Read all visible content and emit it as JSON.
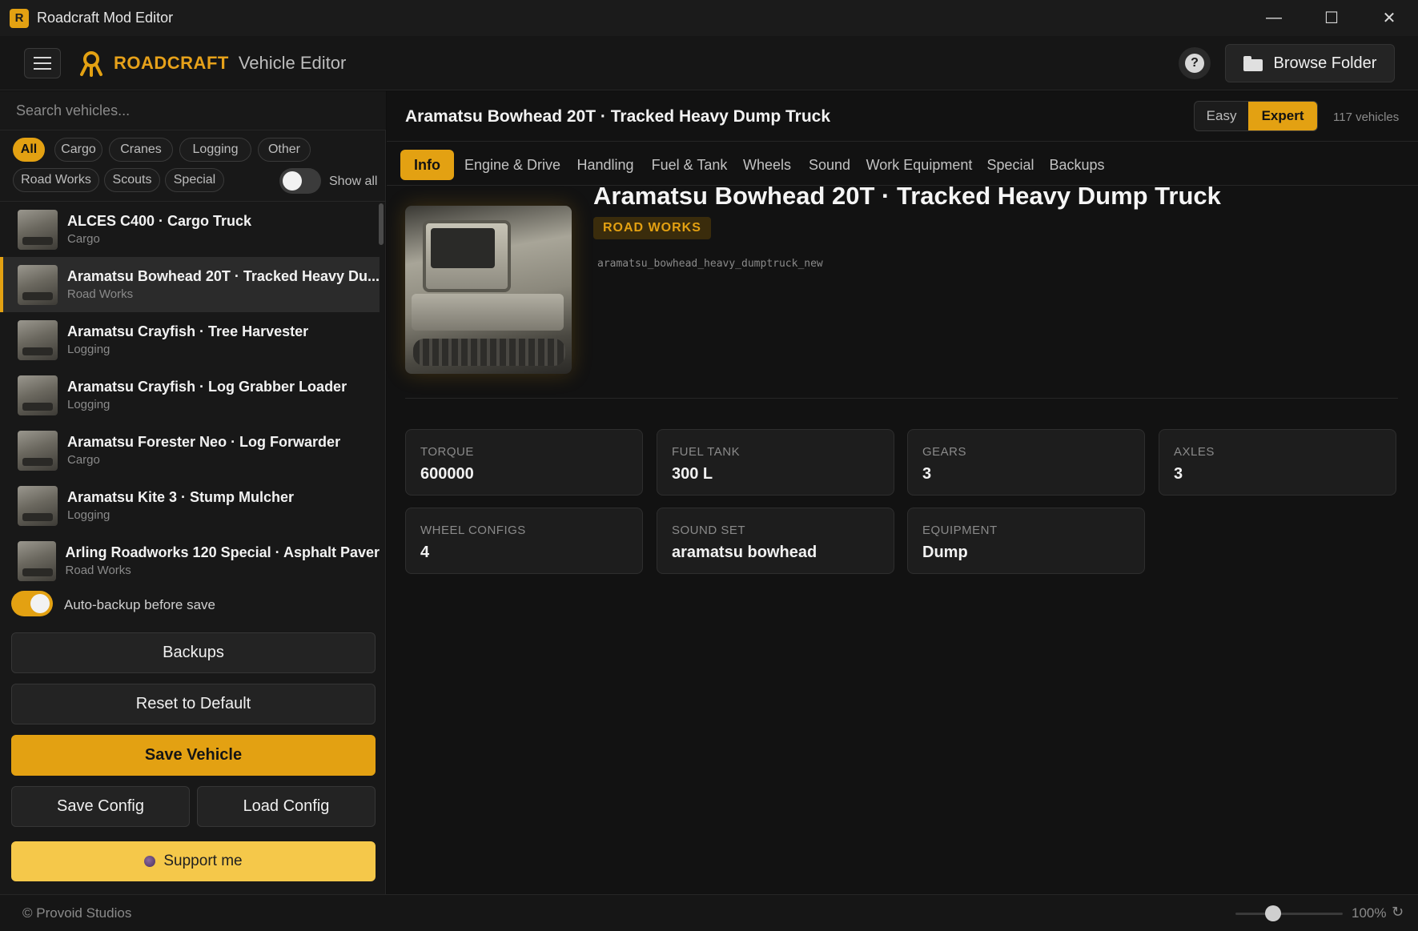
{
  "window": {
    "title": "Roadcraft Mod Editor",
    "controls": {
      "minimize": "—",
      "maximize": "☐",
      "close": "✕"
    }
  },
  "header": {
    "brand": "ROADCRAFT",
    "subtitle": "Vehicle Editor",
    "help": "?",
    "browse_label": "Browse Folder"
  },
  "sidebar": {
    "search_placeholder": "Search vehicles...",
    "filters": [
      "All",
      "Cargo",
      "Cranes",
      "Logging",
      "Other",
      "Road Works",
      "Scouts",
      "Special"
    ],
    "active_filter": "All",
    "show_all_label": "Show all",
    "show_all_on": false,
    "vehicles": [
      {
        "name": "ALCES C400 · Cargo Truck",
        "category": "Cargo",
        "selected": false
      },
      {
        "name": "Aramatsu Bowhead 20T · Tracked Heavy Du...",
        "category": "Road Works",
        "selected": true
      },
      {
        "name": "Aramatsu Crayfish · Tree Harvester",
        "category": "Logging",
        "selected": false
      },
      {
        "name": "Aramatsu Crayfish · Log Grabber Loader",
        "category": "Logging",
        "selected": false
      },
      {
        "name": "Aramatsu Forester Neo · Log Forwarder",
        "category": "Cargo",
        "selected": false
      },
      {
        "name": "Aramatsu Kite 3 · Stump Mulcher",
        "category": "Logging",
        "selected": false
      },
      {
        "name": "Arling Roadworks 120 Special · Asphalt Paver",
        "category": "Road Works",
        "selected": false
      }
    ],
    "autobackup_label": "Auto-backup before save",
    "autobackup_on": true,
    "buttons": {
      "backups": "Backups",
      "reset": "Reset to Default",
      "save_vehicle": "Save Vehicle",
      "save_config": "Save Config",
      "load_config": "Load Config",
      "support": "Support me"
    }
  },
  "main": {
    "title": "Aramatsu Bowhead 20T · Tracked Heavy Dump Truck",
    "mode": {
      "easy": "Easy",
      "expert": "Expert",
      "active": "Expert"
    },
    "vehicle_count": "117 vehicles",
    "tabs": [
      "Info",
      "Engine & Drive",
      "Handling",
      "Fuel & Tank",
      "Wheels",
      "Sound",
      "Work Equipment",
      "Special",
      "Backups"
    ],
    "active_tab": "Info",
    "vehicle": {
      "name": "Aramatsu Bowhead 20T · Tracked Heavy Dump Truck",
      "category_badge": "ROAD WORKS",
      "identifier": "aramatsu_bowhead_heavy_dumptruck_new"
    },
    "stats": [
      {
        "label": "TORQUE",
        "value": "600000"
      },
      {
        "label": "FUEL TANK",
        "value": "300 L"
      },
      {
        "label": "GEARS",
        "value": "3"
      },
      {
        "label": "AXLES",
        "value": "3"
      },
      {
        "label": "WHEEL CONFIGS",
        "value": "4"
      },
      {
        "label": "SOUND SET",
        "value": "aramatsu bowhead"
      },
      {
        "label": "EQUIPMENT",
        "value": "Dump"
      }
    ]
  },
  "statusbar": {
    "copyright": "© Provoid Studios",
    "zoom": "100%",
    "zoom_fraction": 0.35,
    "reset_icon": "↻"
  },
  "colors": {
    "accent": "#e3a112",
    "support": "#f5c84a",
    "background": "#121212",
    "panel": "#181818"
  }
}
